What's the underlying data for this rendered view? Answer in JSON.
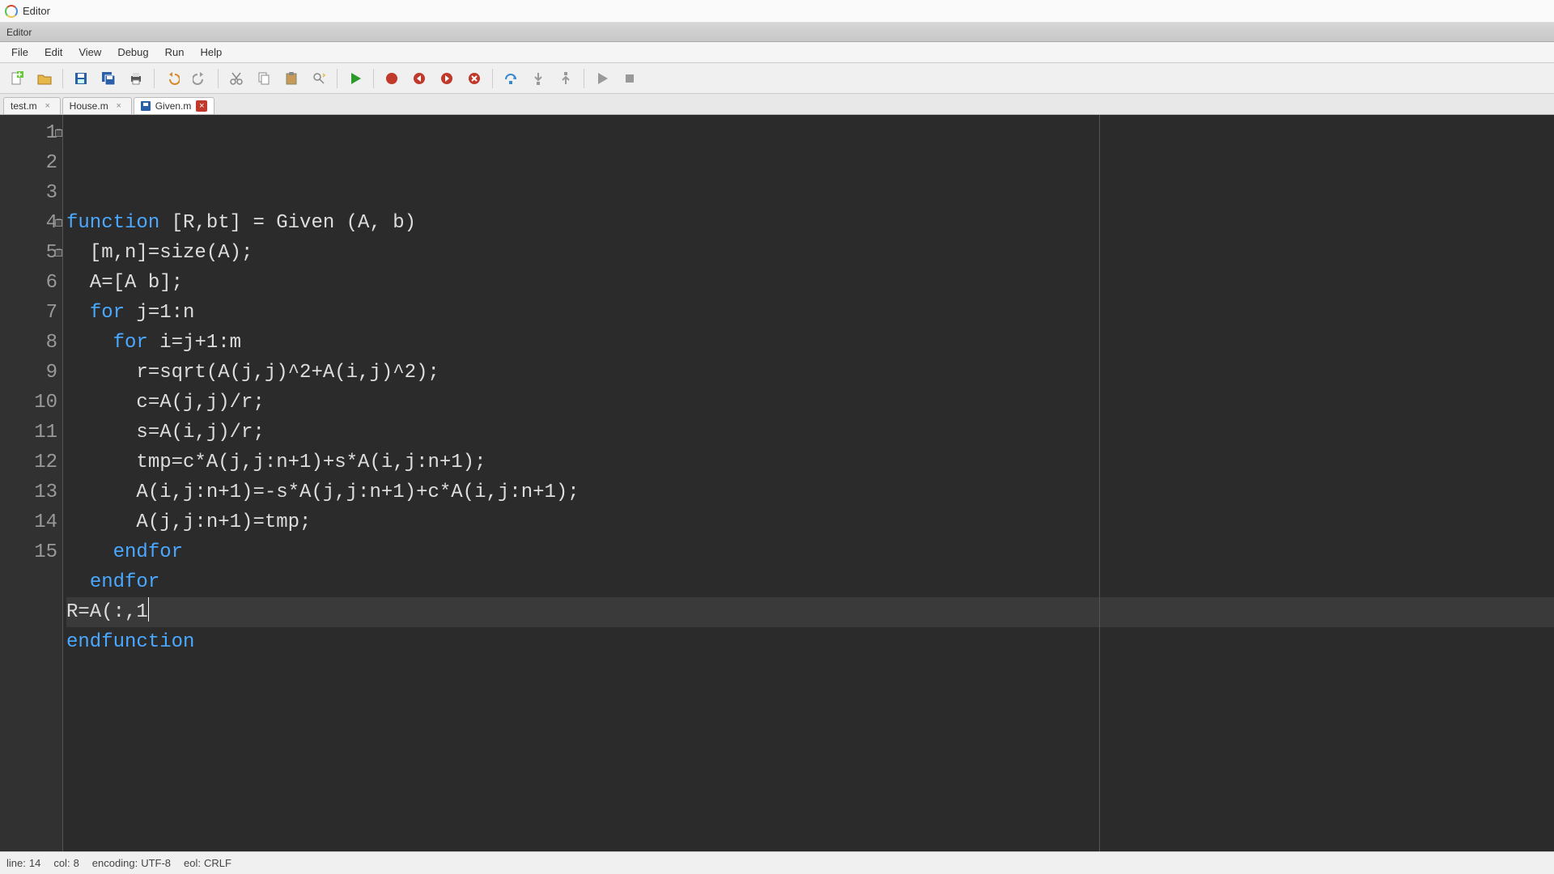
{
  "window": {
    "title": "Editor"
  },
  "dock": {
    "title": "Editor"
  },
  "menu": {
    "file": "File",
    "edit": "Edit",
    "view": "View",
    "debug": "Debug",
    "run": "Run",
    "help": "Help"
  },
  "tabs": [
    {
      "label": "test.m",
      "modified": false,
      "active": false,
      "icon": "none"
    },
    {
      "label": "House.m",
      "modified": false,
      "active": false,
      "icon": "none"
    },
    {
      "label": "Given.m",
      "modified": true,
      "active": true,
      "icon": "save"
    }
  ],
  "code": {
    "lines": [
      {
        "n": 1,
        "fold": true,
        "tokens": [
          [
            "kw",
            "function"
          ],
          [
            "op",
            " [R,bt] = Given (A, b)"
          ]
        ]
      },
      {
        "n": 2,
        "fold": false,
        "tokens": [
          [
            "op",
            "  [m,n]=size(A);"
          ]
        ]
      },
      {
        "n": 3,
        "fold": false,
        "tokens": [
          [
            "op",
            "  A=[A b];"
          ]
        ]
      },
      {
        "n": 4,
        "fold": true,
        "tokens": [
          [
            "op",
            "  "
          ],
          [
            "kw",
            "for"
          ],
          [
            "op",
            " j=1:n"
          ]
        ]
      },
      {
        "n": 5,
        "fold": true,
        "tokens": [
          [
            "op",
            "    "
          ],
          [
            "kw",
            "for"
          ],
          [
            "op",
            " i=j+1:m"
          ]
        ]
      },
      {
        "n": 6,
        "fold": false,
        "tokens": [
          [
            "op",
            "      r=sqrt(A(j,j)^2+A(i,j)^2);"
          ]
        ]
      },
      {
        "n": 7,
        "fold": false,
        "tokens": [
          [
            "op",
            "      c=A(j,j)/r;"
          ]
        ]
      },
      {
        "n": 8,
        "fold": false,
        "tokens": [
          [
            "op",
            "      s=A(i,j)/r;"
          ]
        ]
      },
      {
        "n": 9,
        "fold": false,
        "tokens": [
          [
            "op",
            "      tmp=c*A(j,j:n+1)+s*A(i,j:n+1);"
          ]
        ]
      },
      {
        "n": 10,
        "fold": false,
        "tokens": [
          [
            "op",
            "      A(i,j:n+1)=-s*A(j,j:n+1)+c*A(i,j:n+1);"
          ]
        ]
      },
      {
        "n": 11,
        "fold": false,
        "tokens": [
          [
            "op",
            "      A(j,j:n+1)=tmp;"
          ]
        ]
      },
      {
        "n": 12,
        "fold": false,
        "tokens": [
          [
            "op",
            "    "
          ],
          [
            "kw",
            "endfor"
          ]
        ]
      },
      {
        "n": 13,
        "fold": false,
        "tokens": [
          [
            "op",
            "  "
          ],
          [
            "kw",
            "endfor"
          ]
        ]
      },
      {
        "n": 14,
        "fold": false,
        "tokens": [
          [
            "op",
            "R=A(:,1"
          ]
        ],
        "current": true,
        "cursor_after": true
      },
      {
        "n": 15,
        "fold": false,
        "tokens": [
          [
            "kw",
            "endfunction"
          ]
        ]
      }
    ]
  },
  "status": {
    "line_label": "line:",
    "line_value": "14",
    "col_label": "col:",
    "col_value": "8",
    "encoding_label": "encoding:",
    "encoding_value": "UTF-8",
    "eol_label": "eol:",
    "eol_value": "CRLF"
  }
}
